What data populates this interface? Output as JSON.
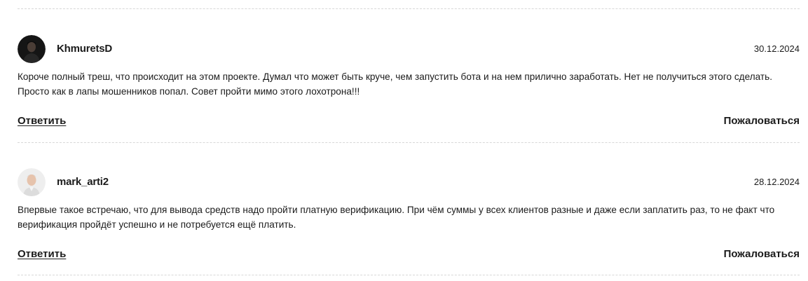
{
  "comments": [
    {
      "username": "KhmuretsD",
      "date": "30.12.2024",
      "avatar_icon": "user-avatar-dark",
      "text": "Короче полный треш, что происходит на этом проекте. Думал что может быть круче, чем запустить бота и на нем прилично заработать. Нет не получиться этого сделать. Просто как в лапы мошенников попал. Совет пройти мимо этого лохотрона!!!",
      "reply_label": "Ответить",
      "report_label": "Пожаловаться"
    },
    {
      "username": "mark_arti2",
      "date": "28.12.2024",
      "avatar_icon": "user-avatar-light",
      "text": "Впервые такое встречаю, что для вывода средств надо пройти платную верификацию. При чём суммы у всех клиентов разные и даже если заплатить раз, то не факт что верификация пройдёт успешно и не потребуется ещё платить.",
      "reply_label": "Ответить",
      "report_label": "Пожаловаться"
    }
  ]
}
